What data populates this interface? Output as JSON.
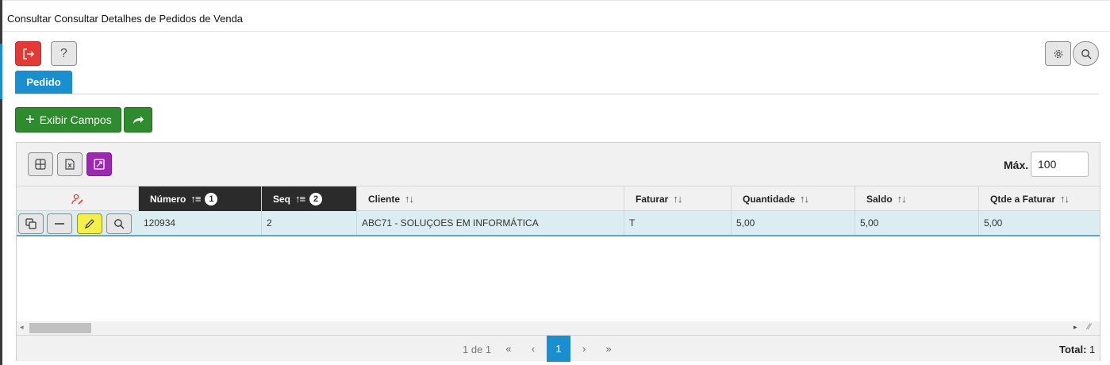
{
  "window": {
    "title": "Consultar Consultar Detalhes de Pedidos de Venda"
  },
  "toolbar": {
    "exit_icon": "logout-icon",
    "help_label": "?",
    "settings_icon": "gear-icon",
    "search_icon": "search-icon"
  },
  "tabs": [
    {
      "label": "Pedido",
      "active": true
    }
  ],
  "actions": {
    "exibir_campos_label": "Exibir Campos",
    "plus_glyph": "+",
    "share_icon": "share-arrow-icon"
  },
  "grid": {
    "max_label": "Máx.",
    "max_value": "100",
    "toolbar_icons": [
      "grid-layout-icon",
      "excel-export-icon",
      "expand-icon"
    ],
    "row_action_header_icon": "user-edit-icon",
    "columns": [
      {
        "label": "Número",
        "sort": "1",
        "active": true
      },
      {
        "label": "Seq",
        "sort": "2",
        "active": true
      },
      {
        "label": "Cliente",
        "sort": ""
      },
      {
        "label": "Faturar",
        "sort": ""
      },
      {
        "label": "Quantidade",
        "sort": ""
      },
      {
        "label": "Saldo",
        "sort": ""
      },
      {
        "label": "Qtde a Faturar",
        "sort": ""
      }
    ],
    "sort_glyph_active": "↑≡",
    "sort_glyph_idle": "↑↓",
    "rows": [
      {
        "numero": "120934",
        "seq": "2",
        "cliente": "ABC71 - SOLUÇOES EM INFORMÁTICA",
        "faturar": "T",
        "quantidade": "5,00",
        "saldo": "5,00",
        "qtde_faturar": "5,00"
      }
    ],
    "row_buttons": [
      "copy-icon",
      "minus-icon",
      "pencil-icon",
      "search-icon"
    ]
  },
  "pager": {
    "info": "1 de 1",
    "first": "«",
    "prev": "‹",
    "current": "1",
    "next": "›",
    "last": "»",
    "total_label": "Total:",
    "total_value": "1"
  },
  "colors": {
    "accent": "#1a8fd0",
    "exit": "#e53935",
    "green": "#2e8b2e",
    "purple": "#9c27b0",
    "row_selected": "#dcedf2",
    "header_dark": "#2b2b2b"
  }
}
